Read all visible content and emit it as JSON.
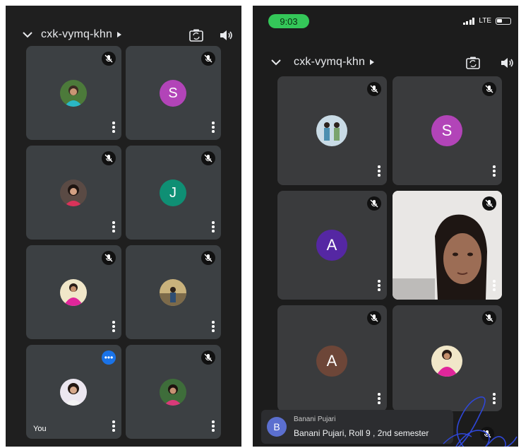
{
  "left_screen": {
    "meeting_code": "cxk-vymq-khn",
    "tiles": [
      {
        "type": "photo",
        "muted": true
      },
      {
        "type": "initial",
        "initial": "S",
        "color": "#b244b8",
        "muted": true
      },
      {
        "type": "photo",
        "muted": true
      },
      {
        "type": "initial",
        "initial": "J",
        "color": "#0f8f74",
        "muted": true
      },
      {
        "type": "photo",
        "muted": true
      },
      {
        "type": "photo",
        "muted": true
      },
      {
        "type": "photo",
        "label": "You",
        "muted": false
      },
      {
        "type": "photo",
        "muted": true
      }
    ]
  },
  "right_screen": {
    "status_time": "9:03",
    "network": "LTE",
    "meeting_code": "cxk-vymq-khn",
    "tiles": [
      {
        "type": "photo",
        "muted": true
      },
      {
        "type": "initial",
        "initial": "S",
        "color": "#b244b8",
        "muted": true
      },
      {
        "type": "initial",
        "initial": "A",
        "color": "#5527a3",
        "muted": true
      },
      {
        "type": "video",
        "muted": true
      },
      {
        "type": "initial",
        "initial": "A",
        "color": "#6d4638",
        "muted": true
      },
      {
        "type": "photo",
        "muted": true
      }
    ],
    "caption": {
      "avatar_initial": "B",
      "speaker": "Banani Pujari",
      "text": "Banani Pujari, Roll 9 , 2nd semester"
    }
  },
  "colors": {
    "background": "#1f1f1f",
    "tile": "#3c4043",
    "status_pill": "#34c759",
    "more_badge": "#1a73e8"
  },
  "icons": [
    "chevron-down-icon",
    "caret-right-icon",
    "camera-flip-icon",
    "speaker-icon",
    "mic-off-icon",
    "more-vert-icon",
    "more-horiz-icon"
  ]
}
